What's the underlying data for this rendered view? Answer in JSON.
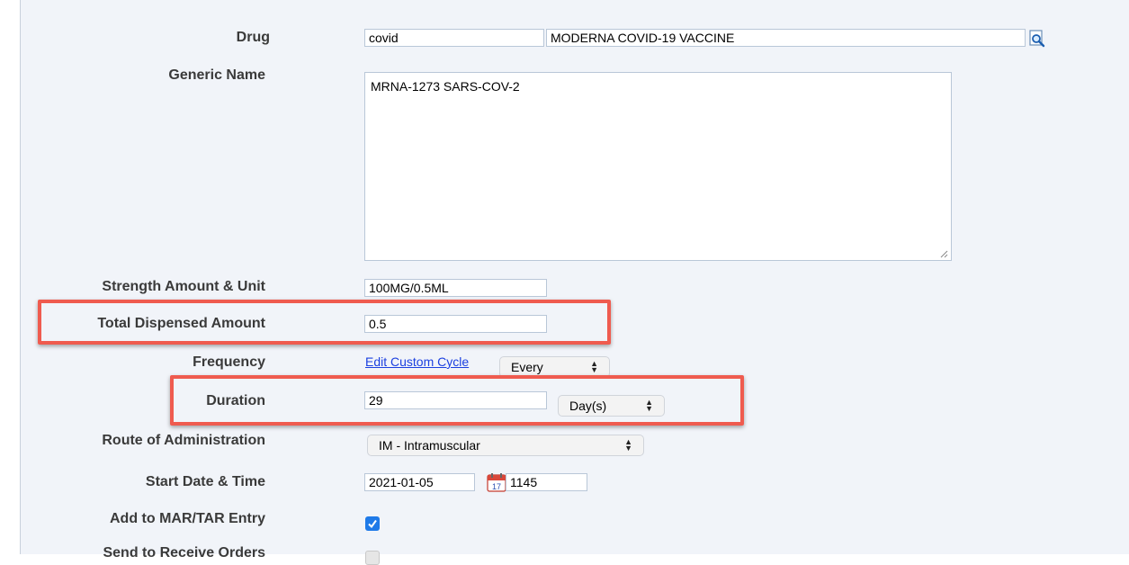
{
  "fields": {
    "drug": {
      "label": "Drug",
      "code": "covid",
      "name": "MODERNA COVID-19 VACCINE"
    },
    "generic_name": {
      "label": "Generic Name",
      "value": "MRNA-1273 SARS-COV-2"
    },
    "strength": {
      "label": "Strength Amount & Unit",
      "value": "100MG/0.5ML"
    },
    "total_dispensed": {
      "label": "Total Dispensed Amount",
      "value": "0.5"
    },
    "frequency": {
      "label": "Frequency",
      "link": "Edit Custom Cycle",
      "select": "Every"
    },
    "duration": {
      "label": "Duration",
      "value": "29",
      "unit": "Day(s)"
    },
    "route": {
      "label": "Route of Administration",
      "value": "IM - Intramuscular"
    },
    "start": {
      "label": "Start Date & Time",
      "date": "2021-01-05",
      "time": "1145",
      "calendar_day": "17"
    },
    "mar_tar": {
      "label": "Add to MAR/TAR Entry",
      "checked": true
    },
    "receive_orders": {
      "label": "Send to Receive Orders",
      "checked": false
    }
  },
  "colors": {
    "highlight": "#ef5b4f",
    "link": "#1a3fe0",
    "checkbox": "#1f7ae8"
  }
}
